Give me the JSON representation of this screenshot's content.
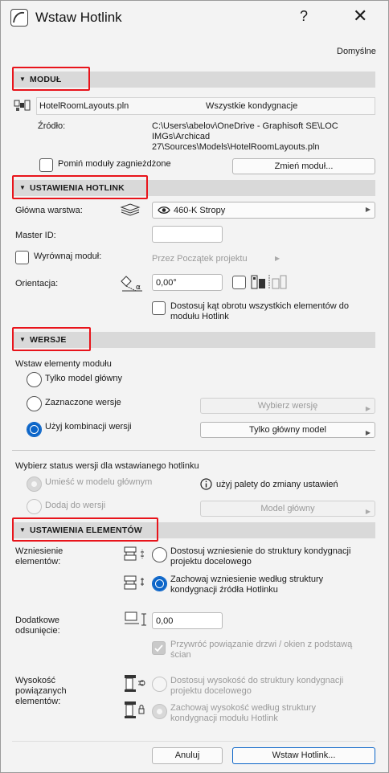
{
  "window": {
    "title": "Wstaw Hotlink",
    "help": "?",
    "close": "✕"
  },
  "defaults_label": "Domyślne",
  "sections": {
    "module": "MODUŁ",
    "hotlink_settings": "USTAWIENIA HOTLINK",
    "versions": "WERSJE",
    "element_settings": "USTAWIENIA ELEMENTÓW"
  },
  "module": {
    "file_name": "HotelRoomLayouts.pln",
    "all_stories": "Wszystkie kondygnacje",
    "source_label": "Źródło:",
    "source_path_1": "C:\\Users\\abelov\\OneDrive - Graphisoft SE\\LOC",
    "source_path_2": "IMGs\\Archicad",
    "source_path_3": "27\\Sources\\Models\\HotelRoomLayouts.pln",
    "skip_nested_label": "Pomiń moduły zagnieżdżone",
    "change_module_button": "Zmień moduł..."
  },
  "hotlink": {
    "main_layer_label": "Główna warstwa:",
    "main_layer_value": "460-K Stropy",
    "master_id_label": "Master ID:",
    "master_id_value": "",
    "align_module_label": "Wyrównaj moduł:",
    "align_module_value": "Przez Początek projektu",
    "orientation_label": "Orientacja:",
    "orientation_value": "0,00°",
    "adjust_rotation_line1": "Dostosuj kąt obrotu wszystkich elementów do",
    "adjust_rotation_line2": "modułu Hotlink"
  },
  "versions": {
    "insert_label": "Wstaw elementy modułu",
    "opt_main_only": "Tylko model główny",
    "opt_marked": "Zaznaczone wersje",
    "opt_combination": "Użyj kombinacji wersji",
    "select_version_button": "Wybierz wersję",
    "main_model_only_button": "Tylko główny model",
    "status_label": "Wybierz status wersji dla wstawianego hotlinku",
    "opt_place_main": "Umieść w modelu głównym",
    "opt_add_to_version": "Dodaj do wersji",
    "info_text": "użyj palety do zmiany ustawień",
    "main_model_button": "Model główny"
  },
  "elements": {
    "elevation_label_1": "Wzniesienie",
    "elevation_label_2": "elementów:",
    "elev_opt1_line1": "Dostosuj wzniesienie do struktury kondygnacji",
    "elev_opt1_line2": "projektu docelowego",
    "elev_opt2_line1": "Zachowaj wzniesienie według struktury",
    "elev_opt2_line2": "kondygnacji źródła Hotlinku",
    "extra_offset_label_1": "Dodatkowe",
    "extra_offset_label_2": "odsunięcie:",
    "extra_offset_value": "0,00",
    "restore_link_line1": "Przywróć powiązanie drzwi / okien z podstawą",
    "restore_link_line2": "ścian",
    "height_label_1": "Wysokość",
    "height_label_2": "powiązanych",
    "height_label_3": "elementów:",
    "height_opt1_line1": "Dostosuj wysokość do struktury kondygnacji",
    "height_opt1_line2": "projektu docelowego",
    "height_opt2_line1": "Zachowaj wysokość według struktury",
    "height_opt2_line2": "kondygnacji modułu Hotlink"
  },
  "footer": {
    "cancel": "Anuluj",
    "place": "Wstaw Hotlink..."
  },
  "colors": {
    "accent": "#0a64c8",
    "highlight": "#e8141b",
    "section_bar": "#d9d9d9"
  }
}
